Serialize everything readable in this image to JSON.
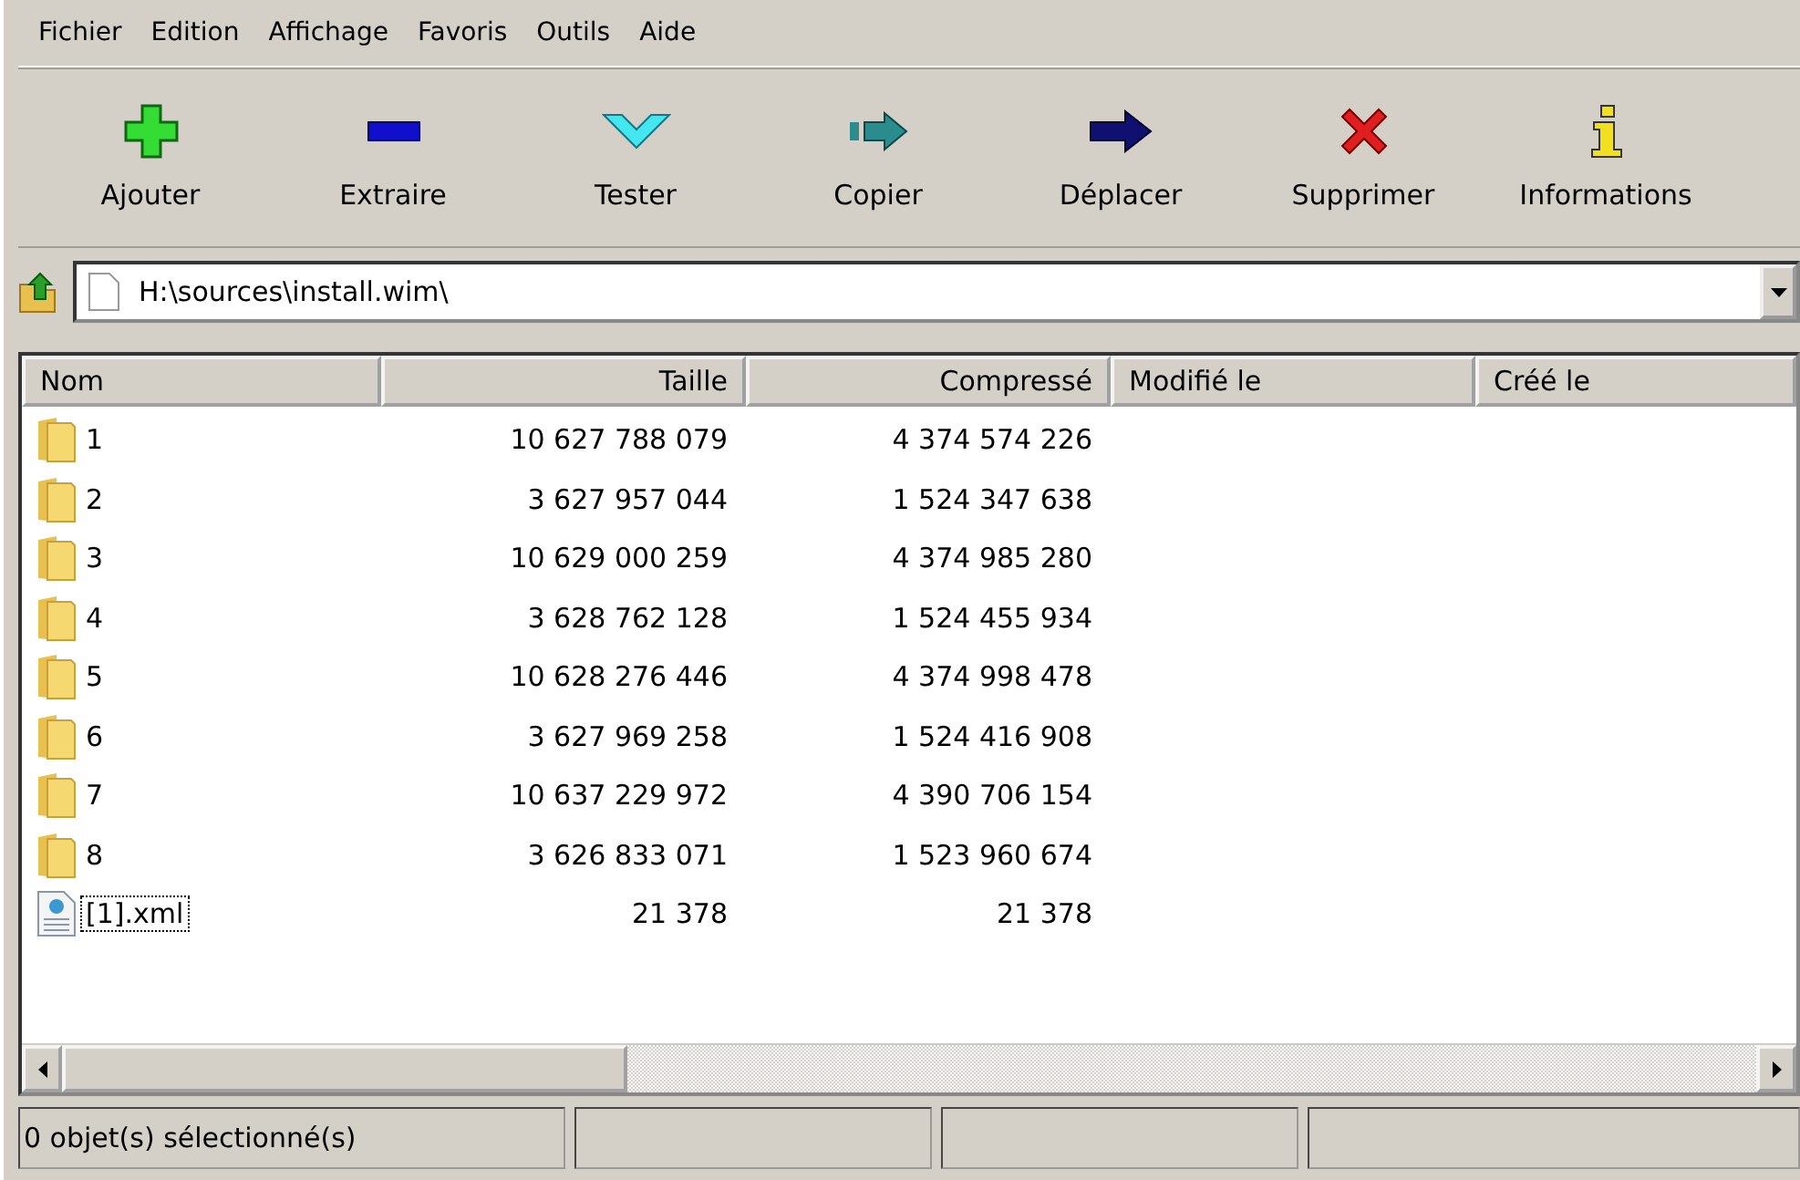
{
  "menu": [
    {
      "label": "Fichier"
    },
    {
      "label": "Edition"
    },
    {
      "label": "Affichage"
    },
    {
      "label": "Favoris"
    },
    {
      "label": "Outils"
    },
    {
      "label": "Aide"
    }
  ],
  "toolbar": [
    {
      "kind": "add",
      "label": "Ajouter"
    },
    {
      "kind": "extract",
      "label": "Extraire"
    },
    {
      "kind": "test",
      "label": "Tester"
    },
    {
      "kind": "copy",
      "label": "Copier"
    },
    {
      "kind": "move",
      "label": "Déplacer"
    },
    {
      "kind": "delete",
      "label": "Supprimer"
    },
    {
      "kind": "info",
      "label": "Informations"
    }
  ],
  "address": {
    "value": "H:\\sources\\install.wim\\"
  },
  "table": {
    "columns": [
      "Nom",
      "Taille",
      "Compressé",
      "Modifié le",
      "Créé le"
    ],
    "rows": [
      {
        "kind": "folder",
        "name": "1",
        "size": "10 627 788 079",
        "packed": "4 374 574 226",
        "focused": false
      },
      {
        "kind": "folder",
        "name": "2",
        "size": "3 627 957 044",
        "packed": "1 524 347 638",
        "focused": false
      },
      {
        "kind": "folder",
        "name": "3",
        "size": "10 629 000 259",
        "packed": "4 374 985 280",
        "focused": false
      },
      {
        "kind": "folder",
        "name": "4",
        "size": "3 628 762 128",
        "packed": "1 524 455 934",
        "focused": false
      },
      {
        "kind": "folder",
        "name": "5",
        "size": "10 628 276 446",
        "packed": "4 374 998 478",
        "focused": false
      },
      {
        "kind": "folder",
        "name": "6",
        "size": "3 627 969 258",
        "packed": "1 524 416 908",
        "focused": false
      },
      {
        "kind": "folder",
        "name": "7",
        "size": "10 637 229 972",
        "packed": "4 390 706 154",
        "focused": false
      },
      {
        "kind": "folder",
        "name": "8",
        "size": "3 626 833 071",
        "packed": "1 523 960 674",
        "focused": false
      },
      {
        "kind": "xml",
        "name": "[1].xml",
        "size": "21 378",
        "packed": "21 378",
        "focused": true
      }
    ]
  },
  "status_bar": {
    "panes": [
      "0 objet(s) sélectionné(s)"
    ]
  }
}
